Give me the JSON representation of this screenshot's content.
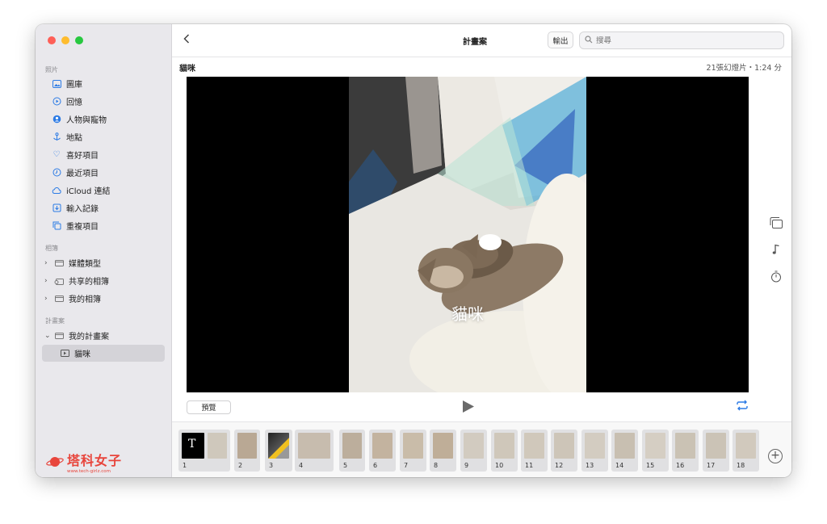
{
  "sidebar": {
    "sections": {
      "photos": "照片",
      "albums": "相簿",
      "projects": "計畫案"
    },
    "items": [
      {
        "label": "圖庫",
        "icon": "photo-library-icon"
      },
      {
        "label": "回憶",
        "icon": "memories-icon"
      },
      {
        "label": "人物與寵物",
        "icon": "people-icon"
      },
      {
        "label": "地點",
        "icon": "places-icon"
      },
      {
        "label": "喜好項目",
        "icon": "heart-icon"
      },
      {
        "label": "最近項目",
        "icon": "clock-icon"
      },
      {
        "label": "iCloud 連結",
        "icon": "icloud-link-icon"
      },
      {
        "label": "輸入記錄",
        "icon": "import-icon"
      },
      {
        "label": "重複項目",
        "icon": "duplicates-icon"
      }
    ],
    "album_groups": [
      {
        "label": "媒體類型"
      },
      {
        "label": "共享的相簿"
      },
      {
        "label": "我的相簿"
      }
    ],
    "project_group": "我的計畫案",
    "project_item": "貓咪"
  },
  "toolbar": {
    "title": "計畫案",
    "export_label": "輸出",
    "search_placeholder": "搜尋"
  },
  "slideshow": {
    "name": "貓咪",
    "info": "21張幻燈片・1:24 分",
    "overlay_text": "貓咪",
    "preview_label": "預覽"
  },
  "filmstrip": {
    "slides": [
      "1",
      "2",
      "3",
      "4",
      "5",
      "6",
      "7",
      "8",
      "9",
      "10",
      "11",
      "12",
      "13",
      "14",
      "15",
      "16",
      "17",
      "18"
    ],
    "first_thumb_letter": "T"
  },
  "watermark": {
    "text": "塔科女子",
    "url": "www.tech-girlz.com"
  },
  "colors": {
    "accent": "#2c7be5",
    "sidebar_bg": "#e9e8ec",
    "watermark": "#e8453c"
  }
}
